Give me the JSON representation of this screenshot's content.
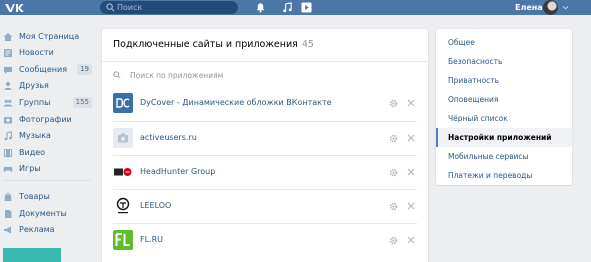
{
  "header": {
    "search_placeholder": "Поиск",
    "user_name": "Елена"
  },
  "sidebar": {
    "items": [
      {
        "label": "Моя Страница",
        "icon": "home-icon"
      },
      {
        "label": "Новости",
        "icon": "news-icon"
      },
      {
        "label": "Сообщения",
        "icon": "messages-icon",
        "count": "19"
      },
      {
        "label": "Друзья",
        "icon": "friends-icon"
      },
      {
        "label": "Группы",
        "icon": "groups-icon",
        "count": "155"
      },
      {
        "label": "Фотографии",
        "icon": "photos-icon"
      },
      {
        "label": "Музыка",
        "icon": "music-icon"
      },
      {
        "label": "Видео",
        "icon": "video-icon"
      },
      {
        "label": "Игры",
        "icon": "games-icon"
      }
    ],
    "secondary": [
      {
        "label": "Товары",
        "icon": "goods-icon"
      },
      {
        "label": "Документы",
        "icon": "documents-icon"
      },
      {
        "label": "Реклама",
        "icon": "ads-icon"
      }
    ]
  },
  "apps_panel": {
    "title": "Подключенные сайты и приложения",
    "count": "45",
    "filter_placeholder": "Поиск по приложениям",
    "apps": [
      {
        "name": "DyCover - Динамические обложки ВКонтакте",
        "logo": "dycover-logo"
      },
      {
        "name": "activeusers.ru",
        "logo": "camera-placeholder-logo"
      },
      {
        "name": "HeadHunter Group",
        "logo": "headhunter-logo"
      },
      {
        "name": "LEELOO",
        "logo": "leeloo-logo"
      },
      {
        "name": "FL.RU",
        "logo": "flru-logo"
      }
    ]
  },
  "settings_menu": {
    "items": [
      {
        "label": "Общее"
      },
      {
        "label": "Безопасность"
      },
      {
        "label": "Приватность"
      },
      {
        "label": "Оповещения"
      },
      {
        "label": "Чёрный список"
      },
      {
        "label": "Настройки приложений",
        "active": true
      },
      {
        "label": "Мобильные сервисы"
      },
      {
        "label": "Платежи и переводы"
      }
    ]
  },
  "colors": {
    "header_bg": "#4a76a8",
    "link": "#2a5885",
    "page_bg": "#edeef0",
    "active_marker": "#5181b8"
  }
}
